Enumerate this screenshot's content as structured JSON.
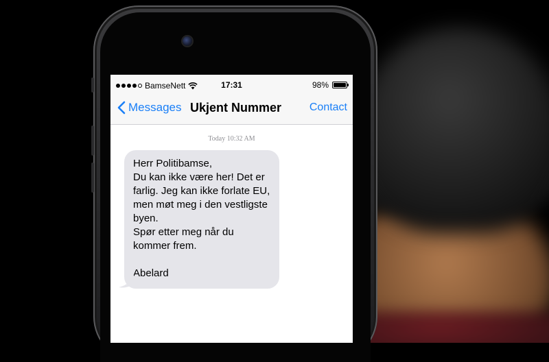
{
  "status_bar": {
    "carrier": "BamseNett",
    "time": "17:31",
    "battery_text": "98%",
    "battery_level": 0.98,
    "signal_bars": 4,
    "signal_total": 5
  },
  "nav": {
    "back_label": "Messages",
    "title": "Ukjent Nummer",
    "contact_label": "Contact"
  },
  "conversation": {
    "timestamp": "Today  10:32 AM",
    "messages": [
      {
        "direction": "incoming",
        "text": "Herr Politibamse,\nDu kan ikke være her! Det er farlig. Jeg kan ikke forlate EU, men møt meg i den vestligste byen.\nSpør etter meg når du kommer frem.\n\nAbelard"
      }
    ]
  },
  "colors": {
    "accent": "#1a7ff7",
    "bubble_incoming": "#e5e5ea",
    "bar_background": "#f7f7f7",
    "timestamp_text": "#8e8e93"
  },
  "icons": {
    "back": "chevron-left-icon",
    "wifi": "wifi-icon",
    "battery": "battery-icon",
    "camera": "front-camera-icon"
  }
}
